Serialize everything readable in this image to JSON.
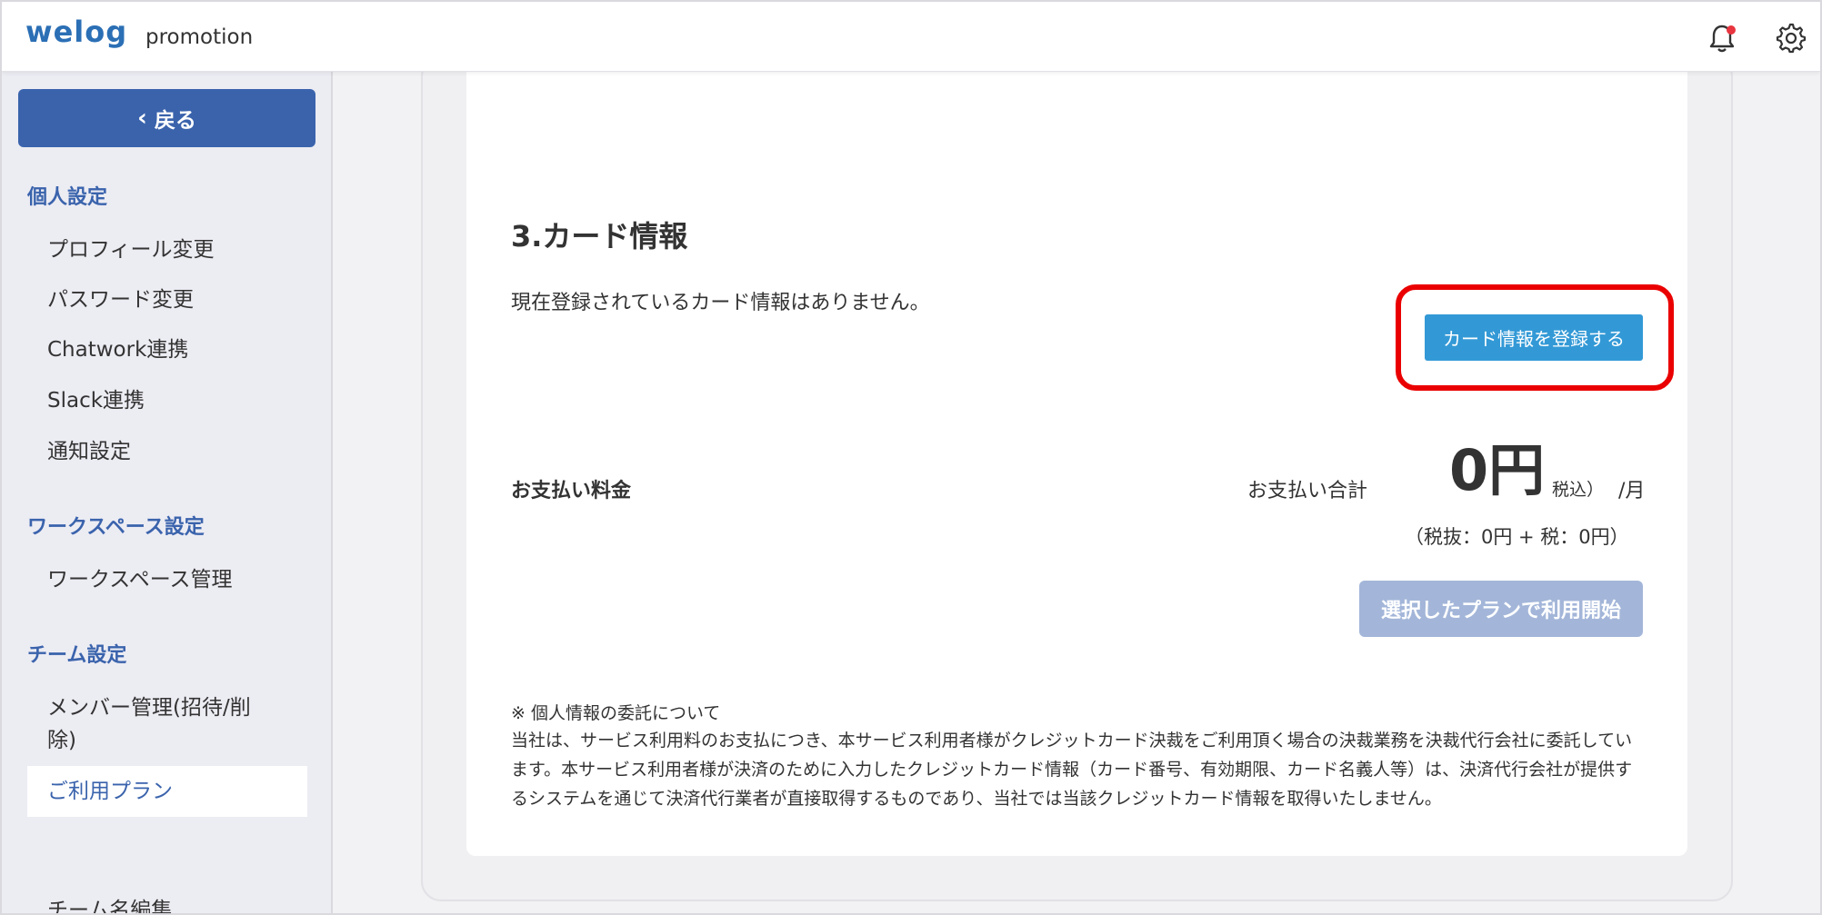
{
  "header": {
    "logo": "welog",
    "workspace": "promotion",
    "bell_icon": "bell-icon",
    "gear_icon": "gear-icon"
  },
  "sidebar": {
    "back_label": "戻る",
    "sections": [
      {
        "title": "個人設定"
      },
      {
        "title": "ワークスペース設定"
      },
      {
        "title": "チーム設定"
      }
    ],
    "items": [
      {
        "label": "プロフィール変更"
      },
      {
        "label": "パスワード変更"
      },
      {
        "label": "Chatwork連携"
      },
      {
        "label": "Slack連携"
      },
      {
        "label": "通知設定"
      },
      {
        "label": "ワークスペース管理"
      },
      {
        "label": "メンバー管理(招待/削除)"
      },
      {
        "label": "ご利用プラン"
      },
      {
        "label": "チーム名編集"
      }
    ],
    "active_item": "ご利用プラン"
  },
  "card": {
    "title": "3.カード情報",
    "message": "現在登録されているカード情報はありません。",
    "register_button": "カード情報を登録する"
  },
  "payment": {
    "label": "お支払い料金",
    "total_label": "お支払い合計",
    "amount": "0円",
    "tax_label": "税込）",
    "per_month": "/月",
    "breakdown": "（税抜：0円 + 税：0円）",
    "start_button": "選択したプランで利用開始"
  },
  "notice": {
    "title": "※ 個人情報の委託について",
    "body": "当社は、サービス利用料のお支払につき、本サービス利用者様がクレジットカード決裁をご利用頂く場合の決裁業務を決裁代行会社に委託しています。本サービス利用者様が決済のために入力したクレジットカード情報（カード番号、有効期限、カード名義人等）は、決済代行会社が提供するシステムを通じて決済代行業者が直接取得するものであり、当社では当該クレジットカード情報を取得いたしません。"
  },
  "colors": {
    "brand": "#2b6fb5",
    "back_button": "#3a63ac",
    "register_button": "#3399d6",
    "start_button_disabled": "#a3b6d9",
    "highlight": "#ea0000"
  }
}
